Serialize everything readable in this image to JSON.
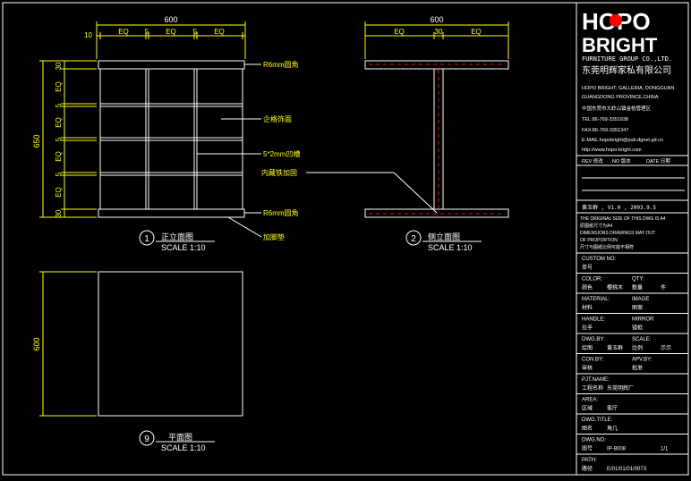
{
  "logo": {
    "line1": "HOPO",
    "line2": "BRIGHT",
    "group": "FURNITURE GROUP CO.,LTD.",
    "company_cn": "东莞明辉家私有限公司"
  },
  "company_info": [
    "HOPO BRIGHT, GALLERIA, DONGGUAN",
    "GUANGDONG PROVINCE,CHINA",
    "中国东莞市大岭山镇金桔管理区",
    "TEL:86-769-3351938",
    "FAX:86-769-3351347",
    "E-MAIL:hopobright@pub.dgnet.gd.cn",
    "http://www.hopo-bright.com"
  ],
  "revision_header": {
    "rev": "REV 修改",
    "no": "NO 版本",
    "date": "DATE 日期"
  },
  "designer_row": "黄玉群 , V1.0 , 2003.9.5",
  "notes": [
    "THE ORIGINAL SIZE OF THIS DWG IS A4",
    "原图纸尺寸为A4",
    "DIMENSIONS DRAWINGS MAY OUT",
    "OF PROPORTION",
    "尺寸与图纸比例可能不相符"
  ],
  "fields": [
    {
      "en": "CUSTOM NO:",
      "cn": "单号",
      "val": ""
    },
    {
      "en": "COLOR:",
      "cn": "颜色",
      "val": "樱桃木",
      "en2": "QTY:",
      "cn2": "数量",
      "val2": "件"
    },
    {
      "en": "MATERIAL:",
      "cn": "材料",
      "val": "",
      "en2": "IMAGE",
      "cn2": "图案",
      "val2": ""
    },
    {
      "en": "HANDLE:",
      "cn": "拉手",
      "val": "",
      "en2": "MIRROR",
      "cn2": "镜框",
      "val2": ""
    },
    {
      "en": "DWG.BY:",
      "cn": "绘图",
      "val": "黄玉群",
      "en2": "SCALE:",
      "cn2": "比例",
      "val2": "示示"
    },
    {
      "en": "CON.BY:",
      "cn": "审核",
      "val": "",
      "en2": "APV.BY:",
      "cn2": "批准",
      "val2": ""
    },
    {
      "en": "PJT.NAME:",
      "cn": "工程名称",
      "val": "东莞明辉厂"
    },
    {
      "en": "AREA:",
      "cn": "区域",
      "val": "客厅"
    },
    {
      "en": "DWG.TITLE:",
      "cn": "图名",
      "val": "角几"
    },
    {
      "en": "DWG.NO:",
      "cn": "图号",
      "val": "IP-8008",
      "val2": "1/1"
    },
    {
      "en": "PATH:",
      "cn": "路径",
      "val": "E/01/01/01/0073"
    }
  ],
  "front_view": {
    "width_dim": "600",
    "top_dims": [
      "10",
      "EQ",
      "5",
      "EQ",
      "5",
      "EQ"
    ],
    "height_dim": "650",
    "side_dims": [
      "30",
      "EQ",
      "5",
      "EQ",
      "5",
      "EQ",
      "5",
      "EQ",
      "30"
    ],
    "callouts": [
      "R6mm圆角",
      "企格饰面",
      "5*2mm凹槽",
      "R6mm圆角",
      "加脚垫"
    ],
    "label_num": "1",
    "label_cn": "正立面图",
    "scale": "SCALE 1:10"
  },
  "side_view": {
    "width_dim": "600",
    "top_dims": [
      "EQ",
      "30",
      "EQ"
    ],
    "callout": "内藏铁加固",
    "label_num": "2",
    "label_cn": "侧立面图",
    "scale": "SCALE 1:10"
  },
  "plan_view": {
    "height_dim": "600",
    "label_num": "9",
    "label_cn": "平面图",
    "scale": "SCALE 1:10"
  },
  "colors": {
    "line": "#ffffff",
    "dim": "#ffff00",
    "accent": "#ff0000",
    "callout": "#ffff00"
  }
}
